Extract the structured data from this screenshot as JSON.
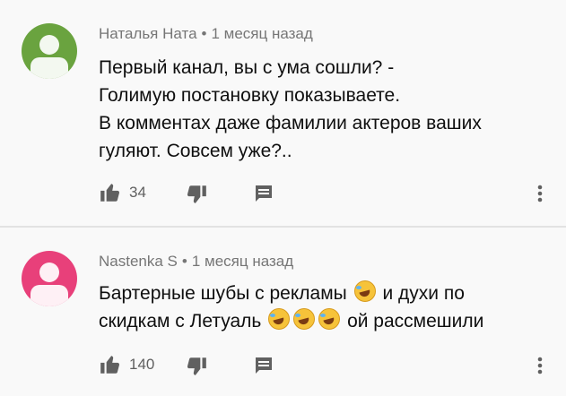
{
  "comments": [
    {
      "author": "Наталья Ната",
      "time": "1 месяц назад",
      "avatar_color": "#6aa33f",
      "lines": [
        "Первый канал, вы с ума сошли? -",
        "Голимую постановку показываете.",
        "В комментах даже фамилии актеров ваших",
        "гуляют. Совсем уже?.."
      ],
      "likes": "34"
    },
    {
      "author": "Nastenka S",
      "time": "1 месяц назад",
      "avatar_color": "#e8407a",
      "line1_a": "Бартерные шубы с рекламы",
      "line1_b": "и духи по",
      "line2_a": "скидкам с Летуаль",
      "line2_b": "ой рассмешили",
      "likes": "140"
    }
  ],
  "icons": {
    "like": "thumb-up-icon",
    "dislike": "thumb-down-icon",
    "reply": "reply-icon",
    "more": "more-vert-icon",
    "emoji": "rolling-on-floor-laughing-emoji"
  },
  "separator": "•"
}
